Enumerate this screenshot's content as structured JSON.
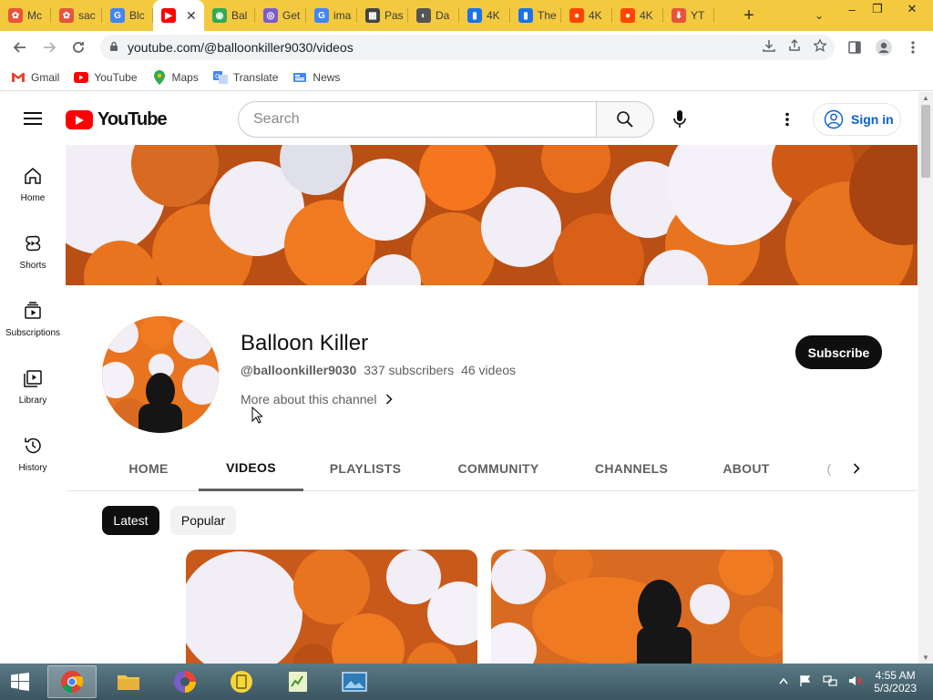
{
  "browser": {
    "tabs": [
      {
        "label": "Mc",
        "fav_color": "#e8543b",
        "fav_glyph": "✿"
      },
      {
        "label": "sac",
        "fav_color": "#e8543b",
        "fav_glyph": "✿"
      },
      {
        "label": "Blc",
        "fav_color": "#4285f4",
        "fav_glyph": "G"
      },
      {
        "label": "",
        "fav_color": "#ff0000",
        "fav_glyph": "▶",
        "active": true
      },
      {
        "label": "Bal",
        "fav_color": "#34a853",
        "fav_glyph": "◉"
      },
      {
        "label": "Get",
        "fav_color": "#7b5cc9",
        "fav_glyph": "◎"
      },
      {
        "label": "ima",
        "fav_color": "#4285f4",
        "fav_glyph": "G"
      },
      {
        "label": "Pas",
        "fav_color": "#444444",
        "fav_glyph": "▦"
      },
      {
        "label": "Da",
        "fav_color": "#555555",
        "fav_glyph": "◐"
      },
      {
        "label": "4K",
        "fav_color": "#1a73e8",
        "fav_glyph": "▮"
      },
      {
        "label": "The",
        "fav_color": "#1a73e8",
        "fav_glyph": "▮"
      },
      {
        "label": "4K",
        "fav_color": "#ff4500",
        "fav_glyph": "●"
      },
      {
        "label": "4K",
        "fav_color": "#ff4500",
        "fav_glyph": "●"
      },
      {
        "label": "YT",
        "fav_color": "#e8543b",
        "fav_glyph": "⬇"
      }
    ],
    "new_tab": "+",
    "tab_search": "⌄",
    "window_controls": {
      "minimize": "–",
      "restore": "❐",
      "close": "✕"
    },
    "url": "youtube.com/@balloonkiller9030/videos",
    "bookmarks": [
      {
        "label": "Gmail",
        "icon": "gmail-icon"
      },
      {
        "label": "YouTube",
        "icon": "youtube-icon"
      },
      {
        "label": "Maps",
        "icon": "maps-icon"
      },
      {
        "label": "Translate",
        "icon": "translate-icon"
      },
      {
        "label": "News",
        "icon": "news-icon"
      }
    ]
  },
  "youtube": {
    "logo_text": "YouTube",
    "search_placeholder": "Search",
    "sign_in": "Sign in",
    "guide": [
      {
        "label": "Home",
        "icon": "home-icon"
      },
      {
        "label": "Shorts",
        "icon": "shorts-icon"
      },
      {
        "label": "Subscriptions",
        "icon": "subscriptions-icon"
      },
      {
        "label": "Library",
        "icon": "library-icon"
      },
      {
        "label": "History",
        "icon": "history-icon"
      }
    ],
    "channel": {
      "name": "Balloon Killer",
      "handle": "@balloonkiller9030",
      "subscribers": "337 subscribers",
      "videos": "46 videos",
      "more": "More about this channel",
      "subscribe": "Subscribe"
    },
    "tabs": [
      "HOME",
      "VIDEOS",
      "PLAYLISTS",
      "COMMUNITY",
      "CHANNELS",
      "ABOUT"
    ],
    "active_tab": "VIDEOS",
    "tab_overflow_glyph": "(",
    "chips": [
      "Latest",
      "Popular"
    ],
    "active_chip": "Latest"
  },
  "taskbar": {
    "time": "4:55 AM",
    "date": "5/3/2023"
  },
  "colors": {
    "tab_strip": "#f3c93f",
    "youtube_red": "#ff0000",
    "link_blue": "#065fd4",
    "balloon_orange": "#e8741f",
    "balloon_white": "#f1eef5"
  }
}
